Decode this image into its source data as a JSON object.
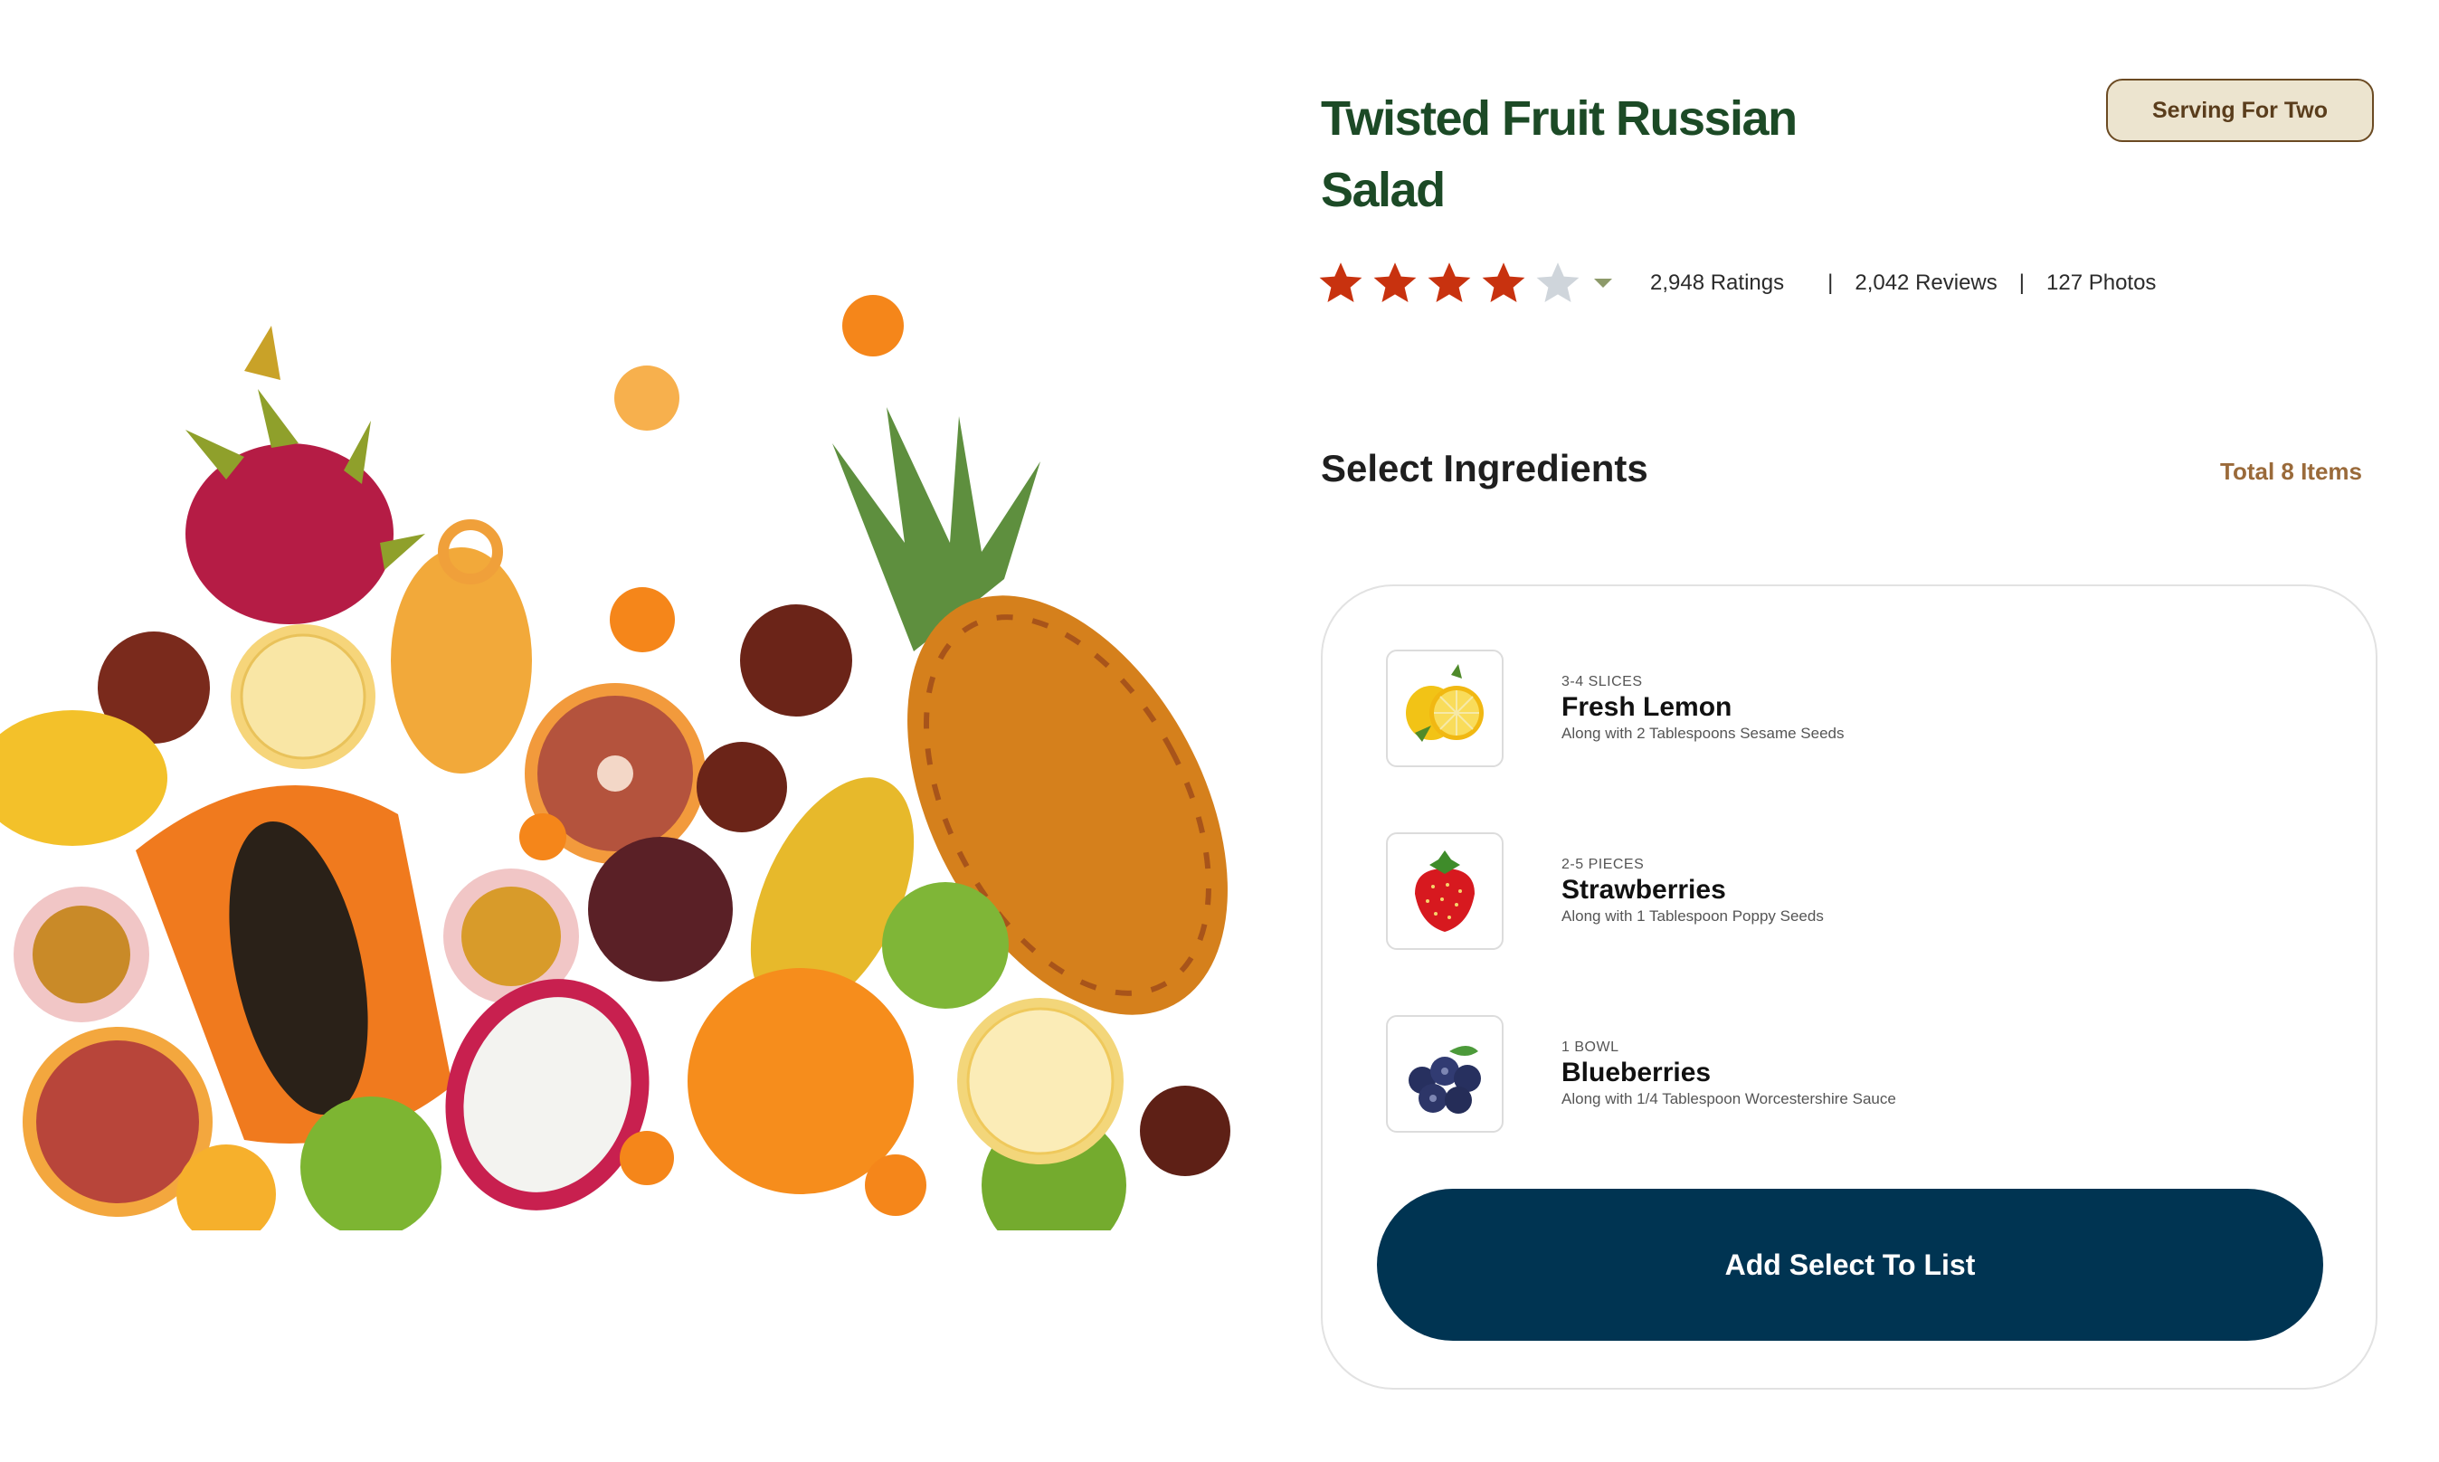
{
  "recipe": {
    "title": "Twisted Fruit Russian Salad",
    "serving_label": "Serving For Two",
    "rating": {
      "value": 4,
      "max": 5
    },
    "ratings_count": "2,948 Ratings",
    "reviews_count": "2,042 Reviews",
    "photos_count": "127 Photos",
    "separator": "|"
  },
  "ingredients_section": {
    "title": "Select Ingredients",
    "total_label": "Total 8 Items",
    "items": [
      {
        "quantity": "3-4 SLICES",
        "name": "Fresh Lemon",
        "note": "Along with 2 Tablespoons Sesame Seeds",
        "icon": "lemon-icon"
      },
      {
        "quantity": "2-5 PIECES",
        "name": "Strawberries",
        "note": "Along with 1 Tablespoon Poppy Seeds",
        "icon": "strawberry-icon"
      },
      {
        "quantity": "1 BOWL",
        "name": "Blueberries",
        "note": "Along with 1/4 Tablespoon Worcestershire Sauce",
        "icon": "blueberry-icon"
      }
    ],
    "button_label": "Add Select To List"
  },
  "colors": {
    "title_green": "#1c4a26",
    "star_filled": "#c8320f",
    "star_empty": "#cfd5db",
    "accent_brown": "#9a6a3a",
    "button_navy": "#003452",
    "badge_bg": "#ece4cf"
  }
}
